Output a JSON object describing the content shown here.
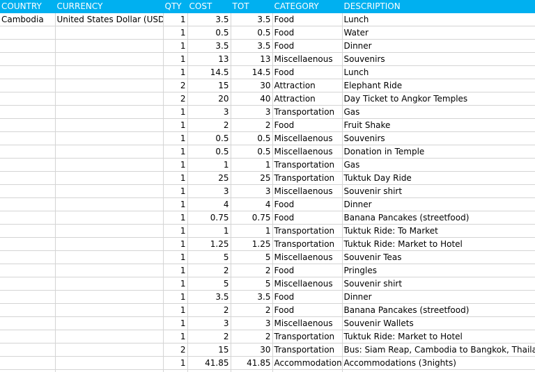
{
  "headers": {
    "country": "COUNTRY",
    "currency": "CURRENCY",
    "qty": "QTY",
    "cost": "COST",
    "tot": "TOT",
    "category": "CATEGORY",
    "description": "DESCRIPTION"
  },
  "colors": {
    "header_bg": "#00b0f0",
    "header_text": "#ffffff",
    "gridline": "#d4d4d4"
  },
  "rows": [
    {
      "country": "Cambodia",
      "currency": "United States Dollar (USD)",
      "qty": "1",
      "cost": "3.5",
      "tot": "3.5",
      "category": "Food",
      "description": "Lunch"
    },
    {
      "country": "",
      "currency": "",
      "qty": "1",
      "cost": "0.5",
      "tot": "0.5",
      "category": "Food",
      "description": "Water"
    },
    {
      "country": "",
      "currency": "",
      "qty": "1",
      "cost": "3.5",
      "tot": "3.5",
      "category": "Food",
      "description": "Dinner"
    },
    {
      "country": "",
      "currency": "",
      "qty": "1",
      "cost": "13",
      "tot": "13",
      "category": "Miscellaenous",
      "description": "Souvenirs"
    },
    {
      "country": "",
      "currency": "",
      "qty": "1",
      "cost": "14.5",
      "tot": "14.5",
      "category": "Food",
      "description": "Lunch"
    },
    {
      "country": "",
      "currency": "",
      "qty": "2",
      "cost": "15",
      "tot": "30",
      "category": "Attraction",
      "description": "Elephant Ride"
    },
    {
      "country": "",
      "currency": "",
      "qty": "2",
      "cost": "20",
      "tot": "40",
      "category": "Attraction",
      "description": "Day Ticket to Angkor Temples"
    },
    {
      "country": "",
      "currency": "",
      "qty": "1",
      "cost": "3",
      "tot": "3",
      "category": "Transportation",
      "description": "Gas"
    },
    {
      "country": "",
      "currency": "",
      "qty": "1",
      "cost": "2",
      "tot": "2",
      "category": "Food",
      "description": "Fruit Shake"
    },
    {
      "country": "",
      "currency": "",
      "qty": "1",
      "cost": "0.5",
      "tot": "0.5",
      "category": "Miscellaenous",
      "description": "Souvenirs"
    },
    {
      "country": "",
      "currency": "",
      "qty": "1",
      "cost": "0.5",
      "tot": "0.5",
      "category": "Miscellaenous",
      "description": "Donation in Temple"
    },
    {
      "country": "",
      "currency": "",
      "qty": "1",
      "cost": "1",
      "tot": "1",
      "category": "Transportation",
      "description": "Gas"
    },
    {
      "country": "",
      "currency": "",
      "qty": "1",
      "cost": "25",
      "tot": "25",
      "category": "Transportation",
      "description": "Tuktuk Day Ride"
    },
    {
      "country": "",
      "currency": "",
      "qty": "1",
      "cost": "3",
      "tot": "3",
      "category": "Miscellaenous",
      "description": "Souvenir shirt"
    },
    {
      "country": "",
      "currency": "",
      "qty": "1",
      "cost": "4",
      "tot": "4",
      "category": "Food",
      "description": "Dinner"
    },
    {
      "country": "",
      "currency": "",
      "qty": "1",
      "cost": "0.75",
      "tot": "0.75",
      "category": "Food",
      "description": "Banana Pancakes (streetfood)"
    },
    {
      "country": "",
      "currency": "",
      "qty": "1",
      "cost": "1",
      "tot": "1",
      "category": "Transportation",
      "description": "Tuktuk Ride: To Market"
    },
    {
      "country": "",
      "currency": "",
      "qty": "1",
      "cost": "1.25",
      "tot": "1.25",
      "category": "Transportation",
      "description": "Tuktuk Ride: Market to Hotel"
    },
    {
      "country": "",
      "currency": "",
      "qty": "1",
      "cost": "5",
      "tot": "5",
      "category": "Miscellaenous",
      "description": "Souvenir Teas"
    },
    {
      "country": "",
      "currency": "",
      "qty": "1",
      "cost": "2",
      "tot": "2",
      "category": "Food",
      "description": "Pringles"
    },
    {
      "country": "",
      "currency": "",
      "qty": "1",
      "cost": "5",
      "tot": "5",
      "category": "Miscellaenous",
      "description": "Souvenir shirt"
    },
    {
      "country": "",
      "currency": "",
      "qty": "1",
      "cost": "3.5",
      "tot": "3.5",
      "category": "Food",
      "description": "Dinner"
    },
    {
      "country": "",
      "currency": "",
      "qty": "1",
      "cost": "2",
      "tot": "2",
      "category": "Food",
      "description": "Banana Pancakes (streetfood)"
    },
    {
      "country": "",
      "currency": "",
      "qty": "1",
      "cost": "3",
      "tot": "3",
      "category": "Miscellaenous",
      "description": "Souvenir Wallets"
    },
    {
      "country": "",
      "currency": "",
      "qty": "1",
      "cost": "2",
      "tot": "2",
      "category": "Transportation",
      "description": "Tuktuk Ride: Market to Hotel"
    },
    {
      "country": "",
      "currency": "",
      "qty": "2",
      "cost": "15",
      "tot": "30",
      "category": "Transportation",
      "description": "Bus: Siam Reap, Cambodia to Bangkok, Thailand"
    },
    {
      "country": "",
      "currency": "",
      "qty": "1",
      "cost": "41.85",
      "tot": "41.85",
      "category": "Accommodation",
      "description": "Accommodations (3nights)"
    }
  ]
}
